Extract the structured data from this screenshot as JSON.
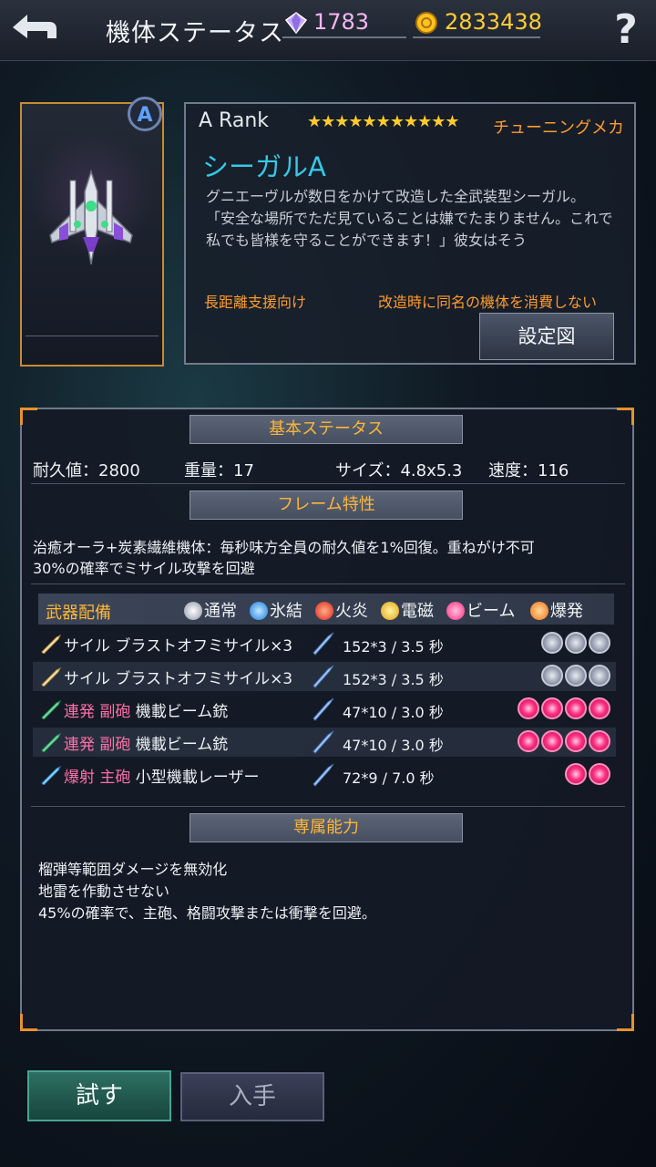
{
  "header": {
    "title": "機体ステータス",
    "gems": "1783",
    "coins": "2833438",
    "help": "?"
  },
  "card": {
    "rank_badge": "A"
  },
  "info": {
    "rank": "A  Rank",
    "stars": "★★★★★★★★★★★",
    "tuning": "チューニングメカ",
    "name": "シーガルA",
    "description": "グニエーヴルが数日をかけて改造した全武装型シーガル。\n「安全な場所でただ見ていることは嫌でたまりません。これで私でも皆様を守ることができます！」彼女はそう",
    "tag_left": "長距離支援向け",
    "tag_right": "改造時に同名の機体を消費しない",
    "setup_button": "設定図"
  },
  "basic": {
    "header": "基本ステータス",
    "durability": "耐久値：2800",
    "weight": "重量：17",
    "size": "サイズ：4.8x5.3",
    "speed": "速度：116"
  },
  "frame": {
    "header": "フレーム特性",
    "line1": "治癒オーラ+炭素繊維機体：毎秒味方全員の耐久値を1%回復。重ねがけ不可",
    "line2": "30%の確率でミサイル攻撃を回避"
  },
  "weapons": {
    "title": "武器配備",
    "legend": [
      "通常",
      "氷結",
      "火炎",
      "電磁",
      "ビーム",
      "爆発"
    ],
    "rows": [
      {
        "prefix": "",
        "name": "サイル  ブラストオフミサイル×3",
        "damage": "152*3  / 3.5 秒",
        "slots": [
          "normal",
          "normal",
          "normal"
        ]
      },
      {
        "prefix": "",
        "name": "サイル  ブラストオフミサイル×3",
        "damage": "152*3  / 3.5 秒",
        "slots": [
          "normal",
          "normal",
          "normal"
        ]
      },
      {
        "prefix": "連発 副砲",
        "name": "  機載ビーム銃",
        "damage": "47*10  / 3.0 秒",
        "slots": [
          "beam",
          "beam",
          "beam",
          "beam"
        ]
      },
      {
        "prefix": "連発 副砲",
        "name": "  機載ビーム銃",
        "damage": "47*10  / 3.0 秒",
        "slots": [
          "beam",
          "beam",
          "beam",
          "beam"
        ]
      },
      {
        "prefix": "爆射 主砲",
        "name": "  小型機載レーザー",
        "damage": "72*9  / 7.0 秒",
        "slots": [
          "beam",
          "beam"
        ]
      }
    ]
  },
  "exclusive": {
    "header": "専属能力",
    "line1": "榴弾等範囲ダメージを無効化",
    "line2": "地雷を作動させない",
    "line3": "45%の確率で、主砲、格闘攻撃または衝撃を回避。"
  },
  "bottom": {
    "try": "試す",
    "get": "入手"
  },
  "colors": {
    "accent": "#ff9b2a",
    "cyan": "#35c9e8",
    "gold": "#ffb636"
  }
}
